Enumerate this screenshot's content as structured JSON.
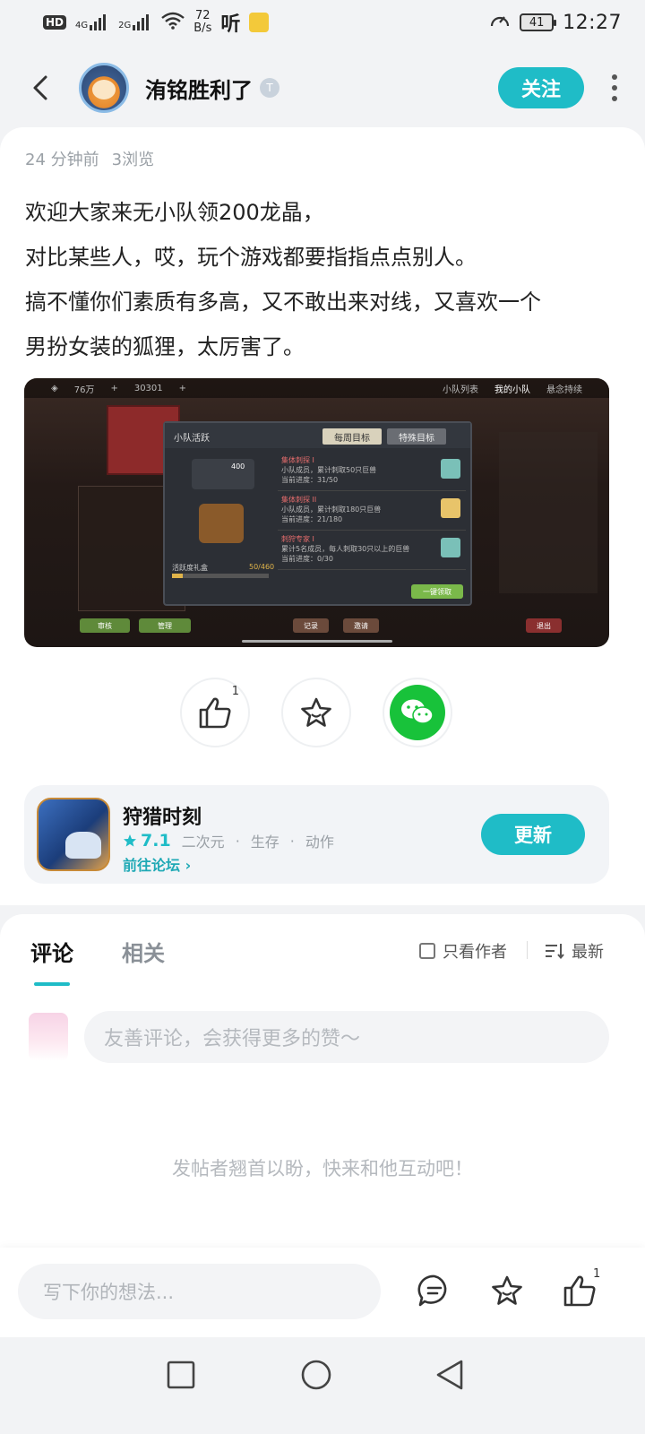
{
  "status_bar": {
    "network_badge": "HD",
    "net1": "4G",
    "net2": "2G",
    "speed_value": "72",
    "speed_unit": "B/s",
    "battery": "41",
    "time": "12:27"
  },
  "header": {
    "username": "洧铭胜利了",
    "user_badge": "T",
    "follow_label": "关注"
  },
  "post": {
    "time_ago": "24 分钟前",
    "views": "3浏览",
    "lines": [
      "欢迎大家来无小队领200龙晶，",
      "对比某些人，哎，玩个游戏都要指指点点别人。",
      "搞不懂你们素质有多高，又不敢出来对线，又喜欢一个",
      "男扮女装的狐狸，太厉害了。"
    ],
    "screenshot": {
      "topbar_res1": "76万",
      "topbar_res2": "30301",
      "tab_list": "小队列表",
      "tab_mine": "我的小队",
      "tab_memorial": "悬念持续",
      "dialog_title": "小队活跃",
      "tab_weekly": "每周目标",
      "tab_special": "特殊目标",
      "reward_count": "400",
      "chest_label": "活跃度礼盒",
      "progress_text": "50/460",
      "goals": [
        {
          "title": "集体刺探 I",
          "desc": "小队成员，累计刺取50只巨兽",
          "progress": "当前进度：31/50"
        },
        {
          "title": "集体刺探 II",
          "desc": "小队成员，累计刺取180只巨兽",
          "progress": "当前进度：21/180"
        },
        {
          "title": "刺狩专家 I",
          "desc": "累计5名成员，每人刺取30只以上的巨兽",
          "progress": "当前进度：0/30"
        }
      ],
      "claim_label": "一键领取",
      "btn_record": "记录",
      "btn_invite": "邀请",
      "btn_exit": "退出",
      "btn_apply": "审核",
      "btn_manage": "管理"
    }
  },
  "actions": {
    "like_count": "1"
  },
  "game": {
    "name": "狩猎时刻",
    "score": "7.1",
    "tags": [
      "二次元",
      "生存",
      "动作"
    ],
    "forum_link": "前往论坛",
    "update_label": "更新"
  },
  "comments": {
    "tab_comments": "评论",
    "tab_related": "相关",
    "author_only": "只看作者",
    "sort_label": "最新",
    "input_placeholder": "友善评论，会获得更多的赞～",
    "empty_text": "发帖者翘首以盼，快来和他互动吧！"
  },
  "bottom_bar": {
    "write_placeholder": "写下你的想法...",
    "like_count": "1"
  },
  "colors": {
    "accent": "#1fbcc7",
    "wechat": "#18c23a"
  }
}
